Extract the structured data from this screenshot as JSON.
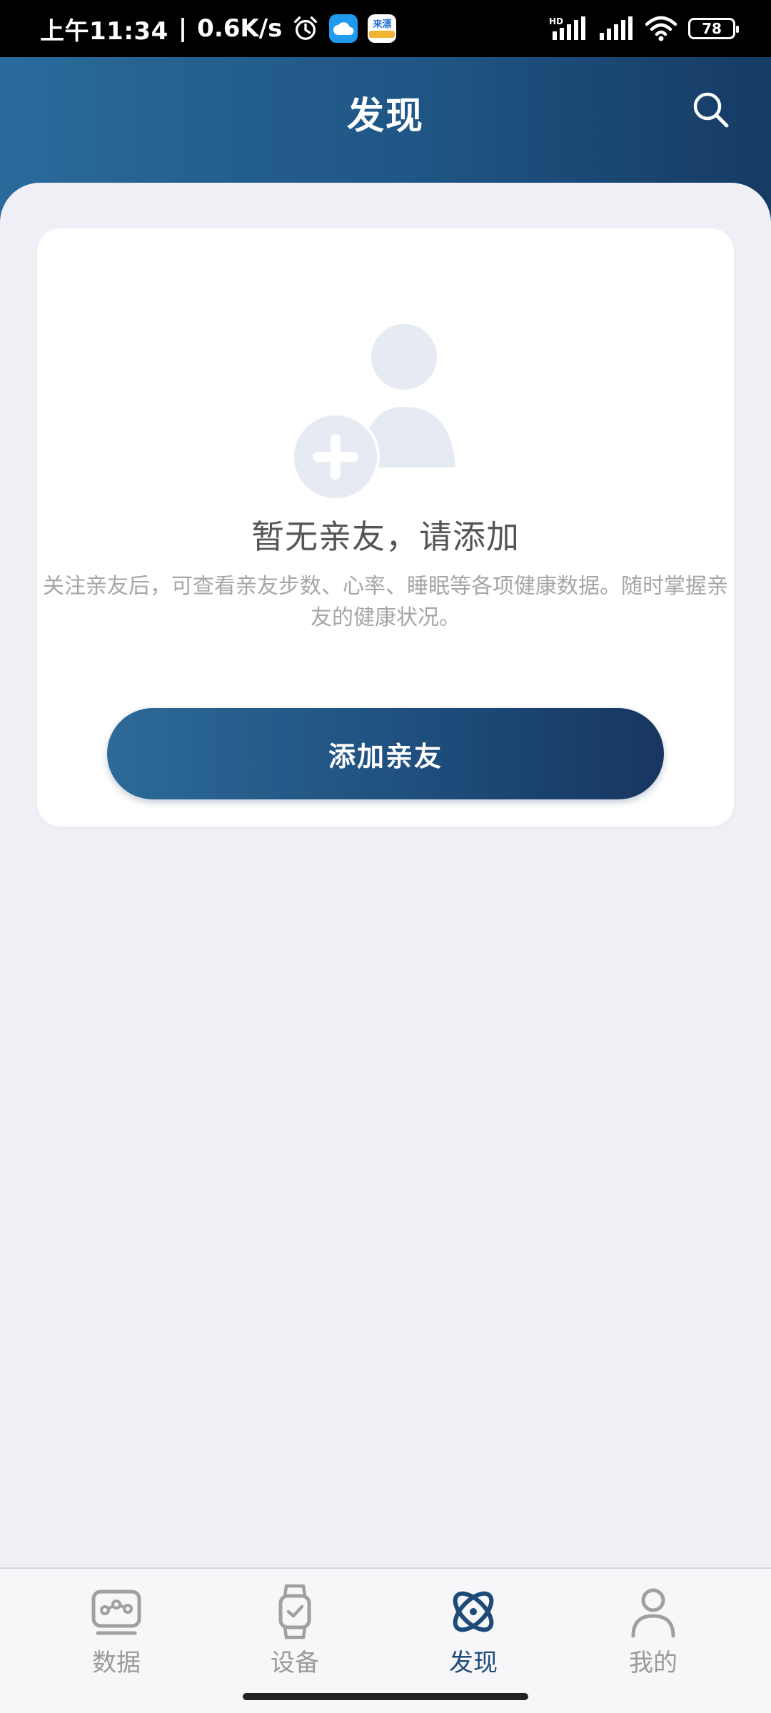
{
  "status_bar": {
    "time": "上午11:34",
    "separator": "|",
    "speed": "0.6K/s",
    "app_badge_text": "来漂",
    "battery": "78"
  },
  "header": {
    "title": "发现"
  },
  "empty_state": {
    "title": "暂无亲友，请添加",
    "description": "关注亲友后，可查看亲友步数、心率、睡眠等各项健康数据。随时掌握亲友的健康状况。",
    "button_label": "添加亲友"
  },
  "nav": {
    "items": [
      {
        "label": "数据",
        "icon": "data-icon",
        "active": false
      },
      {
        "label": "设备",
        "icon": "watch-icon",
        "active": false
      },
      {
        "label": "发现",
        "icon": "discover-icon",
        "active": true
      },
      {
        "label": "我的",
        "icon": "profile-icon",
        "active": false
      }
    ]
  },
  "colors": {
    "header_gradient_start": "#2A6A9A",
    "header_gradient_end": "#163B64",
    "active_nav": "#1E4A78",
    "inactive_nav": "#9A9A9A",
    "illustration": "#E6EAF3"
  }
}
